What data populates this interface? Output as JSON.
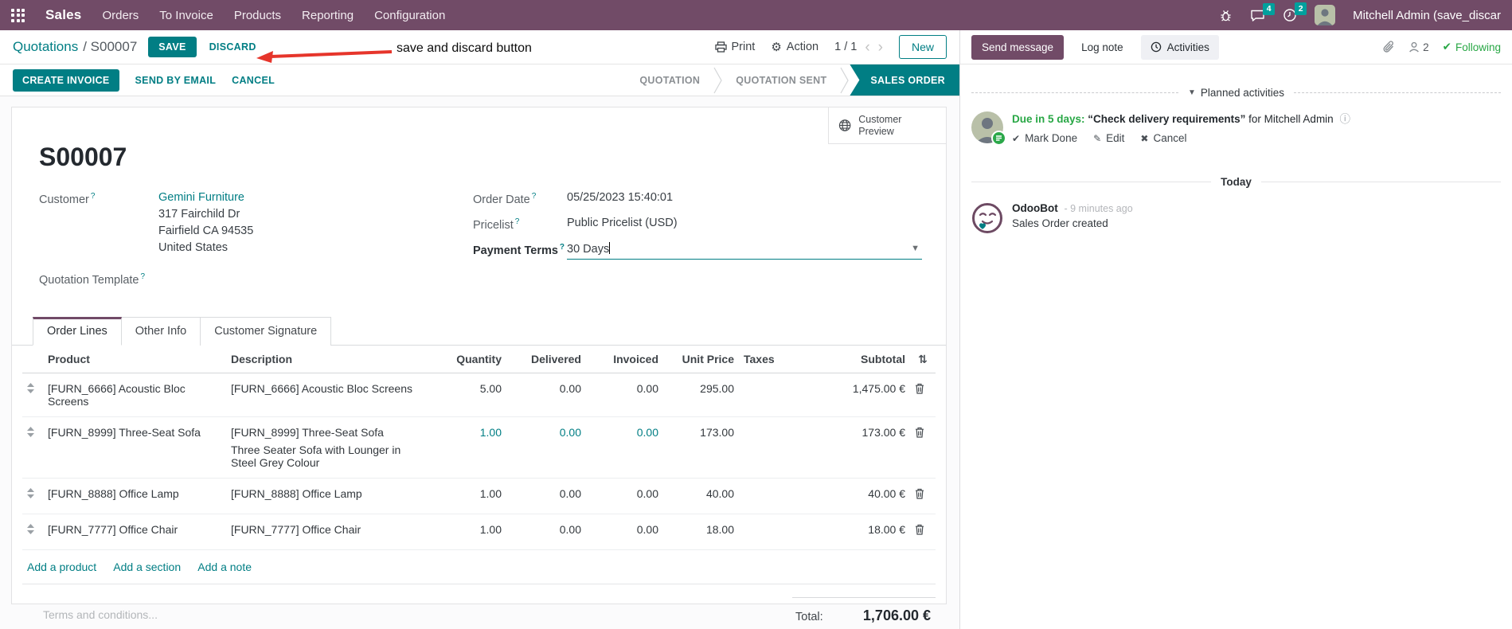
{
  "colors": {
    "brand_purple": "#714B67",
    "accent_teal": "#017E84",
    "badge_teal": "#00A09D",
    "success_green": "#28a745",
    "annotation_red": "#e6352b"
  },
  "navbar": {
    "app_name": "Sales",
    "menus": [
      "Orders",
      "To Invoice",
      "Products",
      "Reporting",
      "Configuration"
    ],
    "messages_badge": "4",
    "activities_badge": "2",
    "user_name": "Mitchell Admin (save_discar"
  },
  "control": {
    "breadcrumb_parent": "Quotations",
    "breadcrumb_current": "/ S00007",
    "save": "SAVE",
    "discard": "DISCARD",
    "annotation": "save and discard button",
    "print": "Print",
    "action": "Action",
    "pager": "1 / 1",
    "new": "New"
  },
  "statusbar": {
    "create_invoice": "CREATE INVOICE",
    "send_by_email": "SEND BY EMAIL",
    "cancel": "CANCEL",
    "steps": [
      {
        "label": "QUOTATION",
        "active": false
      },
      {
        "label": "QUOTATION SENT",
        "active": false
      },
      {
        "label": "SALES ORDER",
        "active": true
      }
    ]
  },
  "sheet": {
    "customer_preview": "Customer Preview",
    "title": "S00007",
    "fields": {
      "hint": "?",
      "customer_label": "Customer",
      "customer_name": "Gemini Furniture",
      "customer_address": [
        "317 Fairchild Dr",
        "Fairfield CA 94535",
        "United States"
      ],
      "quotation_template_label": "Quotation Template",
      "order_date_label": "Order Date",
      "order_date_value": "05/25/2023 15:40:01",
      "pricelist_label": "Pricelist",
      "pricelist_value": "Public Pricelist (USD)",
      "payment_terms_label": "Payment Terms",
      "payment_terms_value": "30 Days"
    },
    "tabs": [
      "Order Lines",
      "Other Info",
      "Customer Signature"
    ],
    "table": {
      "headers": [
        "Product",
        "Description",
        "Quantity",
        "Delivered",
        "Invoiced",
        "Unit Price",
        "Taxes",
        "Subtotal"
      ],
      "lines": [
        {
          "product": "[FURN_6666] Acoustic Bloc Screens",
          "description": "[FURN_6666] Acoustic Bloc Screens",
          "description2": "",
          "quantity": "5.00",
          "delivered": "0.00",
          "invoiced": "0.00",
          "unit_price": "295.00",
          "taxes": "",
          "subtotal": "1,475.00 €"
        },
        {
          "product": "[FURN_8999] Three-Seat Sofa",
          "description": "[FURN_8999] Three-Seat Sofa",
          "description2": "Three Seater Sofa with Lounger in Steel Grey Colour",
          "quantity": "1.00",
          "delivered": "0.00",
          "invoiced": "0.00",
          "unit_price": "173.00",
          "taxes": "",
          "subtotal": "173.00 €"
        },
        {
          "product": "[FURN_8888] Office Lamp",
          "description": "[FURN_8888] Office Lamp",
          "description2": "",
          "quantity": "1.00",
          "delivered": "0.00",
          "invoiced": "0.00",
          "unit_price": "40.00",
          "taxes": "",
          "subtotal": "40.00 €"
        },
        {
          "product": "[FURN_7777] Office Chair",
          "description": "[FURN_7777] Office Chair",
          "description2": "",
          "quantity": "1.00",
          "delivered": "0.00",
          "invoiced": "0.00",
          "unit_price": "18.00",
          "taxes": "",
          "subtotal": "18.00 €"
        }
      ],
      "add_links": [
        "Add a product",
        "Add a section",
        "Add a note"
      ]
    },
    "terms_placeholder": "Terms and conditions...",
    "total_label": "Total:",
    "total_value": "1,706.00 €"
  },
  "chatter": {
    "send_message": "Send message",
    "log_note": "Log note",
    "activities": "Activities",
    "follower_count": "2",
    "following": "Following",
    "planned_title": "Planned activities",
    "activity": {
      "due": "Due in 5 days:",
      "summary": "“Check delivery requirements”",
      "assignee": "for Mitchell Admin",
      "mark_done": "Mark Done",
      "edit": "Edit",
      "cancel": "Cancel"
    },
    "today": "Today",
    "message": {
      "author": "OdooBot",
      "time": "- 9 minutes ago",
      "body": "Sales Order created"
    }
  }
}
